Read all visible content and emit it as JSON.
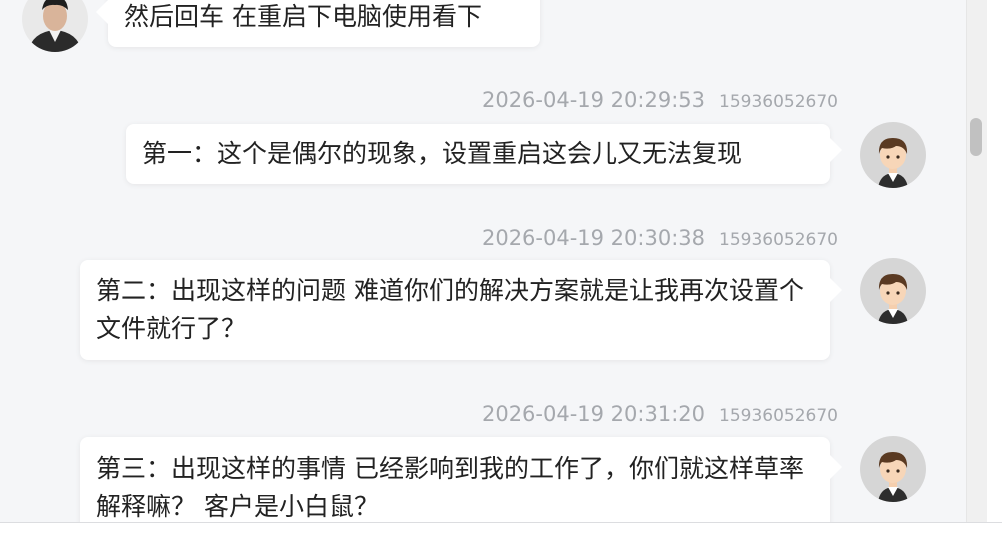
{
  "messages": [
    {
      "side": "left",
      "avatar": "user-photo-avatar",
      "text": "然后回车 在重启下电脑使用看下"
    },
    {
      "side": "right",
      "avatar": "cartoon-boy-avatar",
      "time": "2026-04-19 20:29:53",
      "phone": "15936052670",
      "text": "第一：这个是偶尔的现象，设置重启这会儿又无法复现"
    },
    {
      "side": "right",
      "avatar": "cartoon-boy-avatar",
      "time": "2026-04-19 20:30:38",
      "phone": "15936052670",
      "text": "第二：出现这样的问题 难道你们的解决方案就是让我再次设置个文件就行了？"
    },
    {
      "side": "right",
      "avatar": "cartoon-boy-avatar",
      "time": "2026-04-19 20:31:20",
      "phone": "15936052670",
      "text": "第三：出现这样的事情 已经影响到我的工作了，你们就这样草率解释嘛？ 客户是小白鼠？"
    }
  ],
  "colors": {
    "background": "#f5f6f8",
    "bubble": "#ffffff",
    "meta_text": "#a5a8ad",
    "avatar_bg": "#d6d6d6"
  }
}
